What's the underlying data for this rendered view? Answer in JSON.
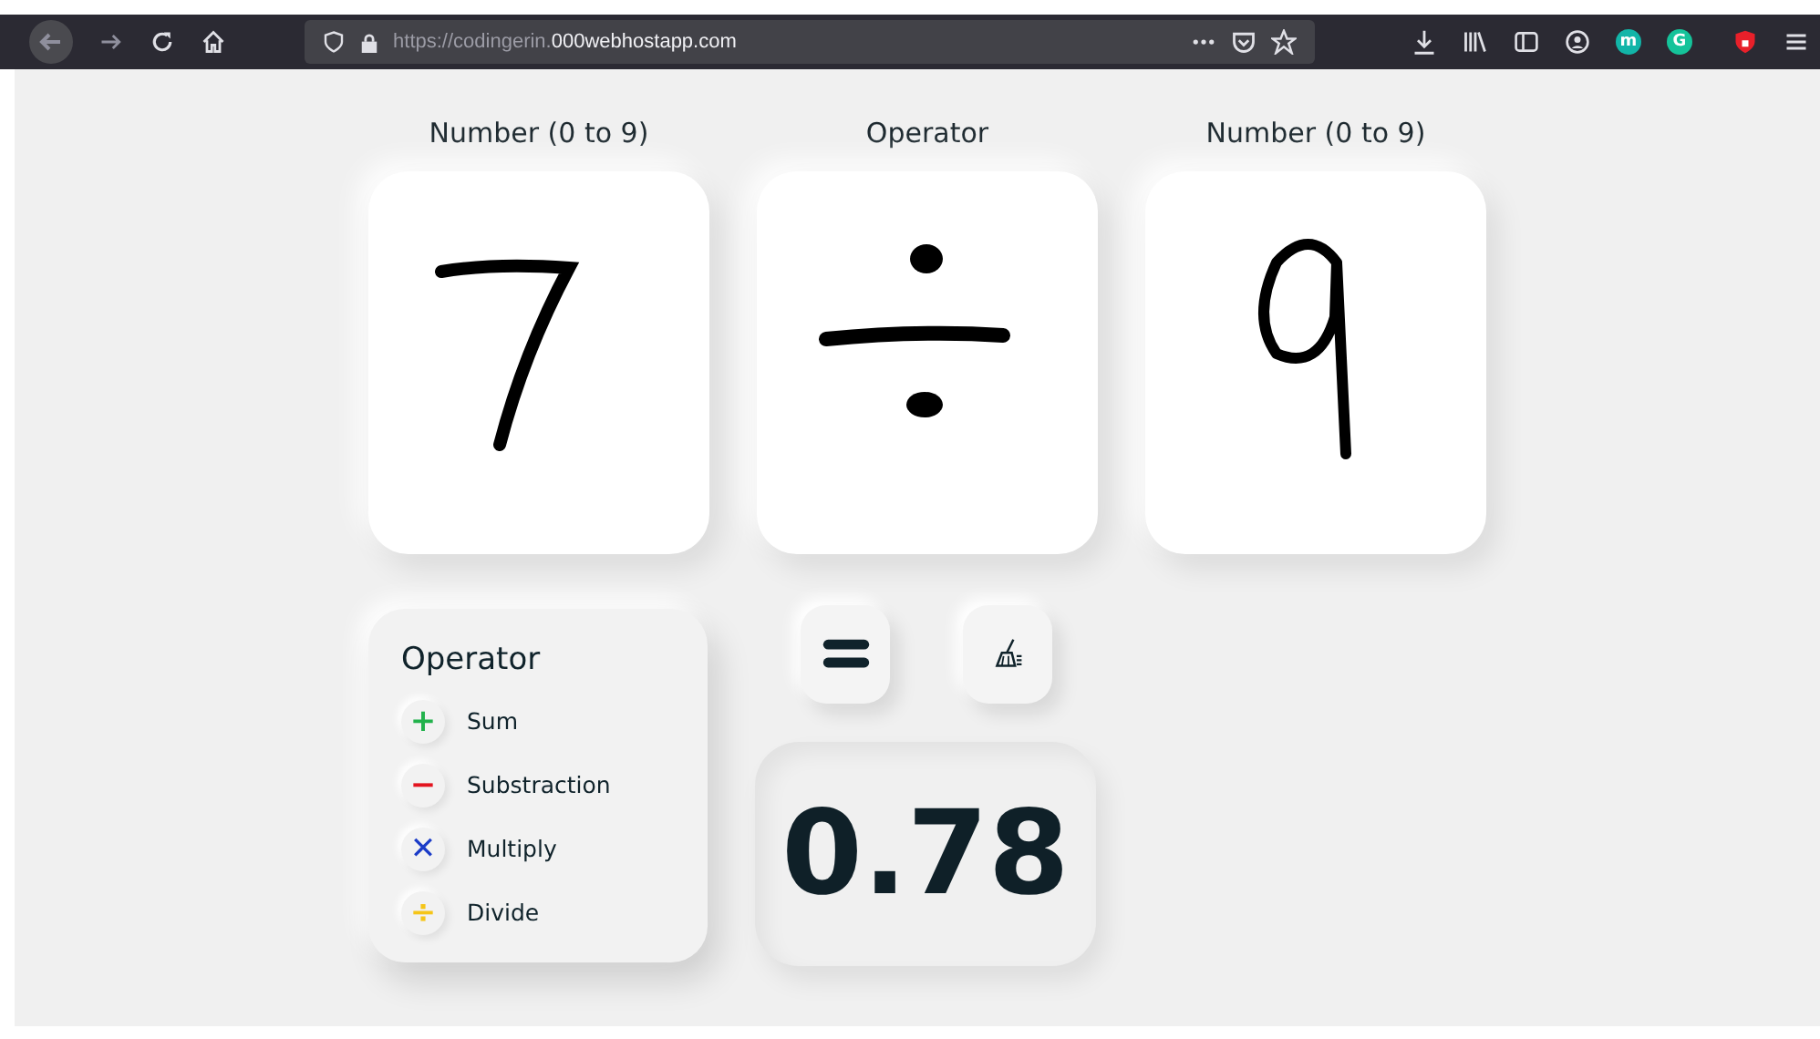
{
  "browser": {
    "url_prefix": "https://codingerin.",
    "url_domain": "000webhostapp.com",
    "extensions": [
      {
        "letter": "m",
        "color": "#12b5a8"
      },
      {
        "letter": "G",
        "color": "#15c39a"
      }
    ]
  },
  "inputs": [
    {
      "label": "Number (0 to 9)",
      "kind": "digit7"
    },
    {
      "label": "Operator",
      "kind": "divide"
    },
    {
      "label": "Number (0 to 9)",
      "kind": "digit9"
    }
  ],
  "legend": {
    "title": "Operator",
    "items": [
      {
        "symbol": "+",
        "label": "Sum",
        "color": "#22b24c"
      },
      {
        "symbol": "−",
        "label": "Substraction",
        "color": "#e3141f"
      },
      {
        "symbol": "✕",
        "label": "Multiply",
        "color": "#1b3cc8"
      },
      {
        "symbol": "÷",
        "label": "Divide",
        "color": "#f5c518"
      }
    ]
  },
  "result": "0.78"
}
